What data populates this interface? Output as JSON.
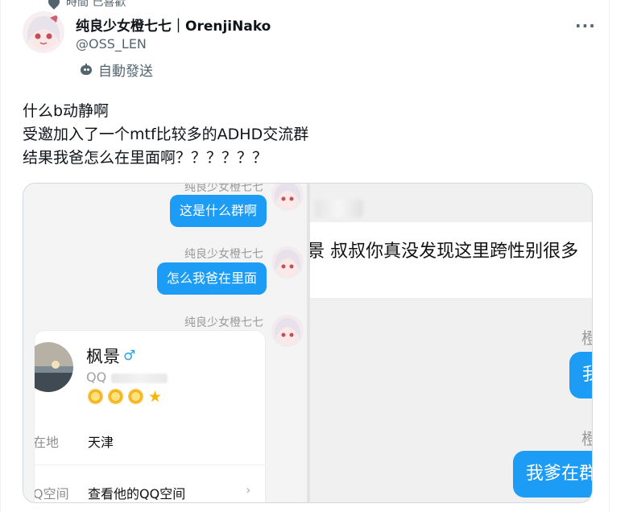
{
  "top": {
    "cut_text": "時間 已喜歡"
  },
  "tweet": {
    "display_name": "纯良少女橙七七｜OrenjiNako",
    "handle": "@OSS_LEN",
    "automated_label": "自動發送",
    "more_icon": "more-horizontal-icon",
    "text_lines": [
      "什么b动静啊",
      "受邀加入了一个mtf比较多的ADHD交流群",
      "结果我爸怎么在里面啊？？？？？？"
    ]
  },
  "chat_left": {
    "sender_name": "纯良少女橙七七",
    "messages": [
      {
        "name": "纯良少女橙七七",
        "text": "这是什么群啊"
      },
      {
        "name": "纯良少女橙七七",
        "text": "怎么我爸在里面"
      },
      {
        "name": "纯良少女橙七七",
        "text": ""
      }
    ],
    "card": {
      "nickname": "枫景",
      "gender_symbol": "♂",
      "qq_prefix": "QQ",
      "rank_icons": [
        "sun-icon",
        "sun-icon",
        "sun-icon",
        "star-icon"
      ],
      "location_label": "在地",
      "location_value": "天津",
      "space_label": "Q空间",
      "space_value": "查看他的QQ空间",
      "chevron": "›"
    }
  },
  "chat_right": {
    "message_text": "l景  叔叔你真没发现这里跨性别很多",
    "name_1": "橙",
    "bubble_1": "我",
    "name_2": "橙",
    "bubble_2": "我爹在群"
  },
  "colors": {
    "bubble_blue": "#1c9cf4",
    "text_primary": "#0f1419",
    "text_secondary": "#536471"
  }
}
